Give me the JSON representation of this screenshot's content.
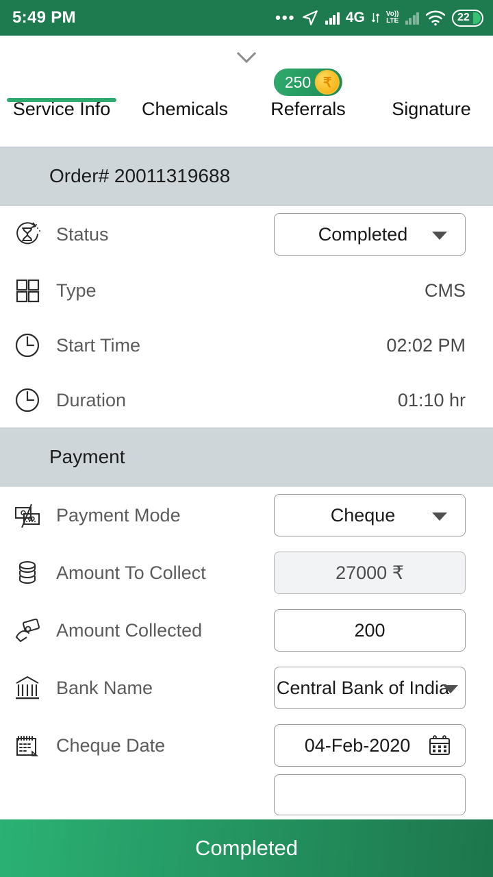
{
  "status_bar": {
    "time": "5:49 PM",
    "battery_level": "22",
    "network_label": "4G",
    "volte_label_top": "Vo))",
    "volte_label_bottom": "LTE",
    "icons": [
      "more-dots-icon",
      "location-arrow-icon",
      "signal-bars-icon",
      "network-4g-icon",
      "volte-icon",
      "signal-bars-dim-icon",
      "wifi-icon",
      "battery-icon"
    ]
  },
  "header": {
    "collapse_icon": "chevron-down-icon"
  },
  "tabs": [
    {
      "label": "Service Info",
      "active": true
    },
    {
      "label": "Chemicals",
      "active": false
    },
    {
      "label": "Referrals",
      "active": false,
      "badge_count": "250",
      "badge_currency": "₹"
    },
    {
      "label": "Signature",
      "active": false
    }
  ],
  "order_section": {
    "title": "Order# 20011319688",
    "rows": [
      {
        "icon": "hourglass-refresh-icon",
        "label": "Status",
        "value": "Completed",
        "control": "dropdown"
      },
      {
        "icon": "grid-squares-icon",
        "label": "Type",
        "value": "CMS",
        "control": "text"
      },
      {
        "icon": "clock-icon",
        "label": "Start Time",
        "value": "02:02 PM",
        "control": "text"
      },
      {
        "icon": "clock-icon",
        "label": "Duration",
        "value": "01:10 hr",
        "control": "text"
      }
    ]
  },
  "payment_section": {
    "title": "Payment",
    "rows": [
      {
        "icon": "cheque-card-icon",
        "label": "Payment Mode",
        "value": "Cheque",
        "control": "dropdown"
      },
      {
        "icon": "coins-stack-icon",
        "label": "Amount To Collect",
        "value": "27000 ₹",
        "control": "readonly-input"
      },
      {
        "icon": "hand-card-icon",
        "label": "Amount Collected",
        "value": "200",
        "control": "input"
      },
      {
        "icon": "bank-icon",
        "label": "Bank Name",
        "value": "Central Bank of India",
        "control": "dropdown"
      },
      {
        "icon": "calendar-icon",
        "label": "Cheque Date",
        "value": "04-Feb-2020",
        "control": "date-input"
      }
    ]
  },
  "bottom_bar": {
    "label": "Completed"
  },
  "colors": {
    "status_bar_green": "#1e7a4f",
    "accent_green": "#2eaa6e",
    "section_header": "#ced6da",
    "badge_green": "#2faa6c",
    "coin_gold": "#f9bf2a",
    "bottom_bar_gradient_start": "#2bb174",
    "bottom_bar_gradient_end": "#1d764c"
  }
}
